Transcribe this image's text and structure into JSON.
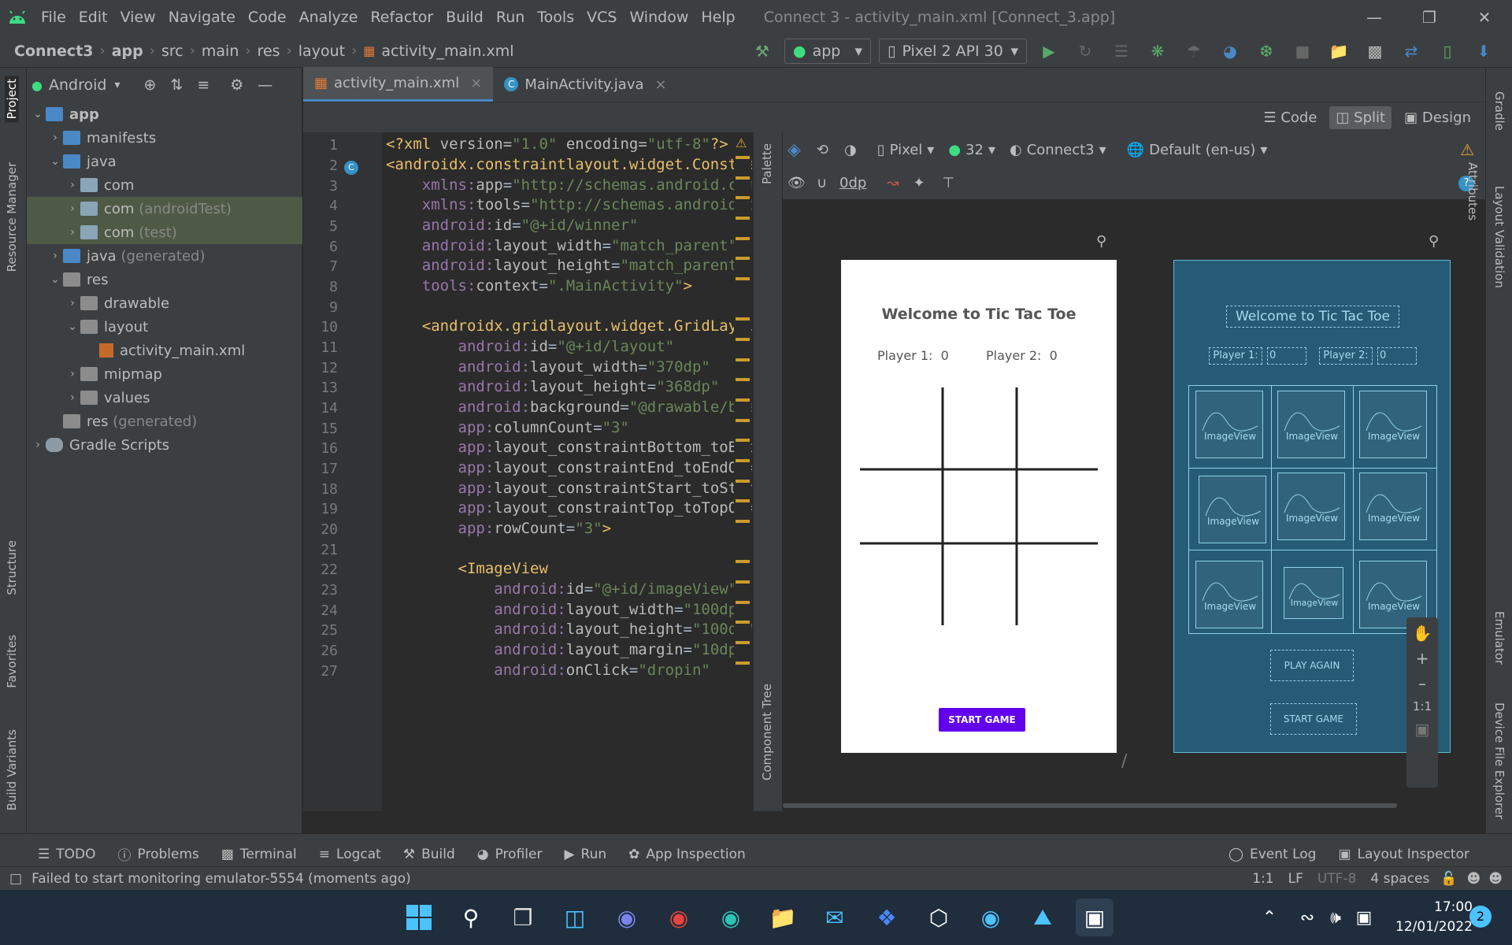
{
  "menubar": {
    "items": [
      "File",
      "Edit",
      "View",
      "Navigate",
      "Code",
      "Analyze",
      "Refactor",
      "Build",
      "Run",
      "Tools",
      "VCS",
      "Window",
      "Help"
    ],
    "window_title": "Connect 3 - activity_main.xml [Connect_3.app]"
  },
  "navbar": {
    "breadcrumbs": [
      "Connect3",
      "app",
      "src",
      "main",
      "res",
      "layout",
      "activity_main.xml"
    ],
    "config": "app",
    "device": "Pixel 2 API 30"
  },
  "project": {
    "view": "Android",
    "tree": [
      {
        "label": "app",
        "extra": ""
      },
      {
        "label": "manifests",
        "extra": ""
      },
      {
        "label": "java",
        "extra": ""
      },
      {
        "label": "com",
        "extra": ""
      },
      {
        "label": "com",
        "extra": "(androidTest)"
      },
      {
        "label": "com",
        "extra": "(test)"
      },
      {
        "label": "java",
        "extra": "(generated)"
      },
      {
        "label": "res",
        "extra": ""
      },
      {
        "label": "drawable",
        "extra": ""
      },
      {
        "label": "layout",
        "extra": ""
      },
      {
        "label": "activity_main.xml",
        "extra": ""
      },
      {
        "label": "mipmap",
        "extra": ""
      },
      {
        "label": "values",
        "extra": ""
      },
      {
        "label": "res",
        "extra": "(generated)"
      },
      {
        "label": "Gradle Scripts",
        "extra": ""
      }
    ]
  },
  "editor": {
    "tabs": [
      "activity_main.xml",
      "MainActivity.java"
    ],
    "modes": [
      "Code",
      "Split",
      "Design"
    ],
    "lines": [
      "1",
      "2",
      "3",
      "4",
      "5",
      "6",
      "7",
      "8",
      "9",
      "10",
      "11",
      "12",
      "13",
      "14",
      "15",
      "16",
      "17",
      "18",
      "19",
      "20",
      "21",
      "22",
      "23",
      "24",
      "25",
      "26",
      "27"
    ]
  },
  "design": {
    "device": "Pixel",
    "api": "32",
    "theme": "Connect3",
    "locale": "Default (en-us)",
    "margin": "0dp",
    "title": "Welcome to Tic Tac Toe",
    "player1_label": "Player 1:",
    "player1_score": "0",
    "player2_label": "Player 2:",
    "player2_score": "0",
    "start_button": "START GAME",
    "play_again_button": "PLAY AGAIN",
    "image_view_label": "ImageView",
    "zoom_reset": "1:1"
  },
  "side_labels": {
    "left": [
      "Project",
      "Resource Manager",
      "Structure",
      "Favorites",
      "Build Variants"
    ],
    "right": [
      "Gradle",
      "Attributes",
      "Layout Validation",
      "Emulator",
      "Device File Explorer"
    ],
    "palette": "Palette",
    "component_tree": "Component Tree"
  },
  "bottom_tabs": [
    "TODO",
    "Problems",
    "Terminal",
    "Logcat",
    "Build",
    "Profiler",
    "Run",
    "App Inspection"
  ],
  "bottom_right": [
    "Event Log",
    "Layout Inspector"
  ],
  "status": {
    "message": "Failed to start monitoring emulator-5554 (moments ago)",
    "position": "1:1",
    "line_sep": "LF",
    "encoding": "UTF-8",
    "indent": "4 spaces"
  },
  "taskbar": {
    "time": "17:00",
    "date": "12/01/2022",
    "notifications": "2"
  },
  "colors": {
    "accent": "#4a88c7",
    "start_button": "#6200ee",
    "blueprint": "#255b74"
  }
}
